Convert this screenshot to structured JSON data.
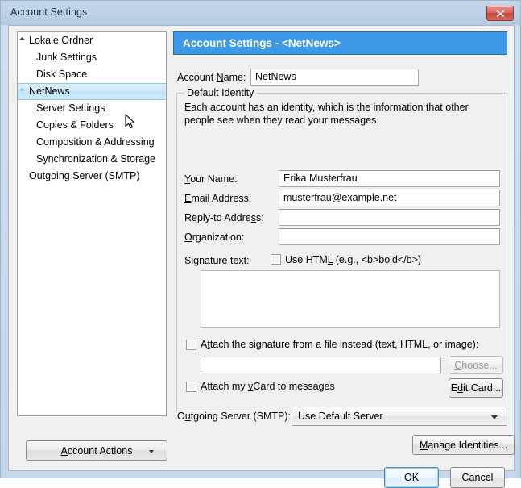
{
  "window": {
    "title": "Account Settings",
    "close_label": "✕",
    "close_icon": "close-icon"
  },
  "sidebar": {
    "items": [
      {
        "label": "Lokale Ordner",
        "level": "root",
        "expander": "expanded-dark",
        "selected": false
      },
      {
        "label": "Junk Settings",
        "level": "child",
        "expander": "none",
        "selected": false
      },
      {
        "label": "Disk Space",
        "level": "child",
        "expander": "none",
        "selected": false
      },
      {
        "label": "NetNews",
        "level": "root",
        "expander": "expanded-light",
        "selected": true
      },
      {
        "label": "Server Settings",
        "level": "child",
        "expander": "none",
        "selected": false
      },
      {
        "label": "Copies & Folders",
        "level": "child",
        "expander": "none",
        "selected": false
      },
      {
        "label": "Composition & Addressing",
        "level": "child",
        "expander": "none",
        "selected": false
      },
      {
        "label": "Synchronization & Storage",
        "level": "child",
        "expander": "none",
        "selected": false
      },
      {
        "label": "Outgoing Server (SMTP)",
        "level": "smtp",
        "expander": "none",
        "selected": false
      }
    ],
    "account_actions": {
      "label_before": "A",
      "label_accel": "A",
      "label": "Account Actions",
      "arrow_icon": "chevron-down-icon"
    }
  },
  "pane": {
    "header": "Account Settings -  <NetNews>",
    "account_name": {
      "label": "Account Name:",
      "accel": "N",
      "value": "NetNews"
    },
    "group": {
      "legend": "Default Identity",
      "description": "Each account has an identity, which is the information that other people see when they read your messages.",
      "fields": [
        {
          "label": "Your Name:",
          "accel": "Y",
          "value": "Erika Musterfrau",
          "placeholder": ""
        },
        {
          "label": "Email Address:",
          "accel": "E",
          "value": "musterfrau@example.net",
          "placeholder": ""
        },
        {
          "label": "Reply-to Address:",
          "accel": "s",
          "value": "",
          "placeholder": ""
        },
        {
          "label": "Organization:",
          "accel": "O",
          "value": "",
          "placeholder": ""
        }
      ],
      "signature": {
        "label": "Signature text:",
        "accel": "x",
        "use_html_label": "Use HTML (e.g., <b>bold</b>)",
        "use_html_accel": "L",
        "use_html_checked": false,
        "text_value": ""
      },
      "attach_file": {
        "label": "Attach the signature from a file instead (text, HTML, or image):",
        "accel": "t",
        "checked": false,
        "path_value": "",
        "choose_button": "Choose...",
        "choose_accel": "C",
        "choose_disabled": true
      },
      "vcard": {
        "label": "Attach my vCard to messages",
        "accel": "v",
        "checked": false,
        "edit_button": "Edit Card...",
        "edit_accel": "d",
        "edit_disabled": false
      }
    },
    "smtp": {
      "label": "Outgoing Server (SMTP):",
      "accel": "u",
      "selected_option": "Use Default Server",
      "options": [
        "Use Default Server"
      ],
      "arrow_icon": "chevron-down-icon"
    }
  },
  "footer": {
    "manage_identities": "Manage Identities...",
    "manage_accel": "M",
    "ok": "OK",
    "cancel": "Cancel"
  },
  "colors": {
    "header_blue": "#3d99e8",
    "titlebar": "#bcd2e6",
    "body": "#f0f0f0",
    "close_red": "#c2483d",
    "selection": "#cde8fa"
  }
}
